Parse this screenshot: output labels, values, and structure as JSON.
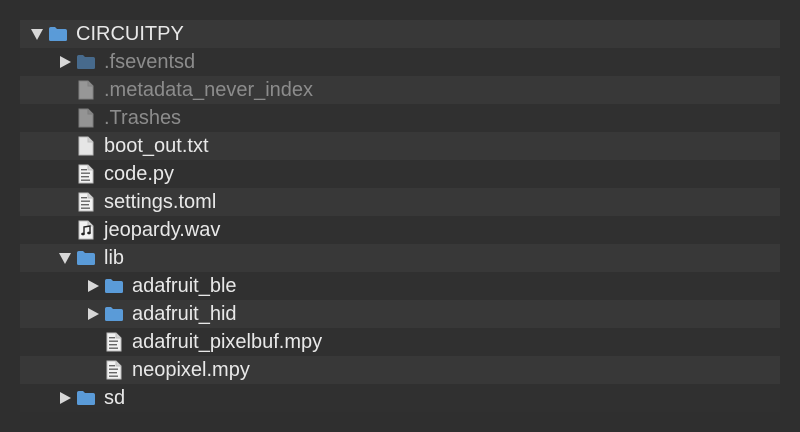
{
  "colors": {
    "folder": "#5b9bd8",
    "text": "#e8e8e8",
    "dim_text": "#8c8c8c",
    "row_odd": "#383838",
    "row_even": "#303030"
  },
  "tree": [
    {
      "name": "CIRCUITPY",
      "kind": "folder",
      "depth": 0,
      "expanded": true,
      "hidden": false
    },
    {
      "name": ".fseventsd",
      "kind": "folder",
      "depth": 1,
      "expanded": false,
      "hidden": true
    },
    {
      "name": ".metadata_never_index",
      "kind": "file",
      "depth": 1,
      "hidden": true
    },
    {
      "name": ".Trashes",
      "kind": "file",
      "depth": 1,
      "hidden": true
    },
    {
      "name": "boot_out.txt",
      "kind": "file",
      "depth": 1,
      "hidden": false
    },
    {
      "name": "code.py",
      "kind": "script",
      "depth": 1,
      "hidden": false
    },
    {
      "name": "settings.toml",
      "kind": "script",
      "depth": 1,
      "hidden": false
    },
    {
      "name": "jeopardy.wav",
      "kind": "audio",
      "depth": 1,
      "hidden": false
    },
    {
      "name": "lib",
      "kind": "folder",
      "depth": 1,
      "expanded": true,
      "hidden": false
    },
    {
      "name": "adafruit_ble",
      "kind": "folder",
      "depth": 2,
      "expanded": false,
      "hidden": false
    },
    {
      "name": "adafruit_hid",
      "kind": "folder",
      "depth": 2,
      "expanded": false,
      "hidden": false
    },
    {
      "name": "adafruit_pixelbuf.mpy",
      "kind": "script",
      "depth": 2,
      "hidden": false
    },
    {
      "name": "neopixel.mpy",
      "kind": "script",
      "depth": 2,
      "hidden": false
    },
    {
      "name": "sd",
      "kind": "folder",
      "depth": 1,
      "expanded": false,
      "hidden": false
    }
  ]
}
